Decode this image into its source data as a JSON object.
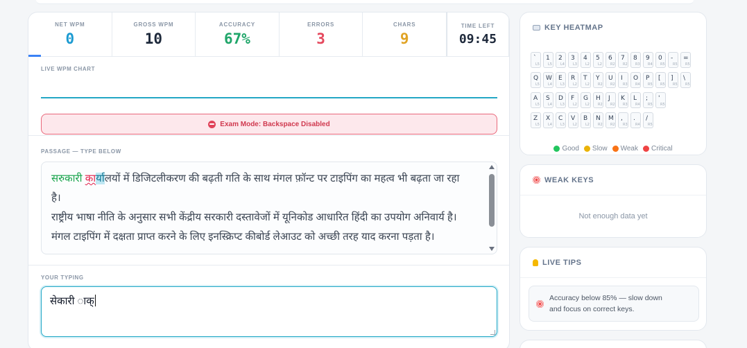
{
  "stats": {
    "net_wpm": {
      "label": "NET WPM",
      "value": "0",
      "color": "#1d9bd1"
    },
    "gross_wpm": {
      "label": "GROSS WPM",
      "value": "10",
      "color": "#1e293b"
    },
    "accuracy": {
      "label": "ACCURACY",
      "value": "67%",
      "color": "#20a66a"
    },
    "errors": {
      "label": "ERRORS",
      "value": "3",
      "color": "#e5485d"
    },
    "chars": {
      "label": "CHARS",
      "value": "9",
      "color": "#e0a324"
    },
    "time_left": {
      "label": "TIME LEFT",
      "value": "09:45"
    }
  },
  "chart": {
    "label": "LIVE WPM CHART"
  },
  "exam_banner": {
    "text": "Exam Mode: Backspace Disabled",
    "icon": "ban-icon"
  },
  "passage": {
    "label": "PASSAGE — TYPE BELOW",
    "typed_correct": "सर",
    "typed_error": "ु",
    "after_error": "कारी ",
    "typed_error_2": "का",
    "current": "र्य",
    "rest_line1": "ालयों में डिजिटलीकरण की बढ़ती गति के साथ मंगल फ़ॉन्ट पर टाइपिंग का महत्व भी बढ़ता जा रहा",
    "line2": "है।",
    "line3": "राष्ट्रीय भाषा नीति के अनुसार सभी केंद्रीय सरकारी दस्तावेजों में यूनिकोड आधारित हिंदी का उपयोग अनिवार्य है।",
    "line4": "मंगल टाइपिंग में दक्षता प्राप्त करने के लिए इनस्क्रिप्ट कीबोर्ड लेआउट को अच्छी तरह याद करना पड़ता है।"
  },
  "typing": {
    "label": "YOUR TYPING",
    "value": "सेकारी ाक्"
  },
  "heatmap": {
    "title": "KEY HEATMAP",
    "rows": [
      [
        [
          "`",
          "L5"
        ],
        [
          "1",
          "L5"
        ],
        [
          "2",
          "L4"
        ],
        [
          "3",
          "L3"
        ],
        [
          "4",
          "L2"
        ],
        [
          "5",
          "L2"
        ],
        [
          "6",
          "R2"
        ],
        [
          "7",
          "R2"
        ],
        [
          "8",
          "R3"
        ],
        [
          "9",
          "R4"
        ],
        [
          "0",
          "R5"
        ],
        [
          "-",
          "R5"
        ],
        [
          "=",
          "R5"
        ]
      ],
      [
        [
          "Q",
          "L5"
        ],
        [
          "W",
          "L4"
        ],
        [
          "E",
          "L3"
        ],
        [
          "R",
          "L2"
        ],
        [
          "T",
          "L2"
        ],
        [
          "Y",
          "R2"
        ],
        [
          "U",
          "R2"
        ],
        [
          "I",
          "R3"
        ],
        [
          "O",
          "R4"
        ],
        [
          "P",
          "R5"
        ],
        [
          "[",
          "R5"
        ],
        [
          "]",
          "R5"
        ],
        [
          "\\",
          "R5"
        ]
      ],
      [
        [
          "A",
          "L5"
        ],
        [
          "S",
          "L4"
        ],
        [
          "D",
          "L3"
        ],
        [
          "F",
          "L2"
        ],
        [
          "G",
          "L2"
        ],
        [
          "H",
          "R2"
        ],
        [
          "J",
          "R2"
        ],
        [
          "K",
          "R3"
        ],
        [
          "L",
          "R4"
        ],
        [
          ";",
          "R5"
        ],
        [
          "'",
          "R5"
        ]
      ],
      [
        [
          "Z",
          "L5"
        ],
        [
          "X",
          "L4"
        ],
        [
          "C",
          "L3"
        ],
        [
          "V",
          "L2"
        ],
        [
          "B",
          "L2"
        ],
        [
          "N",
          "R2"
        ],
        [
          "M",
          "R2"
        ],
        [
          ",",
          "R3"
        ],
        [
          ".",
          "R4"
        ],
        [
          "/",
          "R5"
        ]
      ]
    ],
    "legend": [
      {
        "label": "Good",
        "color": "#22c55e"
      },
      {
        "label": "Slow",
        "color": "#eab308"
      },
      {
        "label": "Weak",
        "color": "#f97316"
      },
      {
        "label": "Critical",
        "color": "#ef4444"
      }
    ]
  },
  "weak_keys": {
    "title": "WEAK KEYS",
    "empty": "Not enough data yet"
  },
  "live_tips": {
    "title": "LIVE TIPS",
    "tip_line1": "Accuracy below 85% — slow down",
    "tip_line2": "and focus on correct keys."
  }
}
